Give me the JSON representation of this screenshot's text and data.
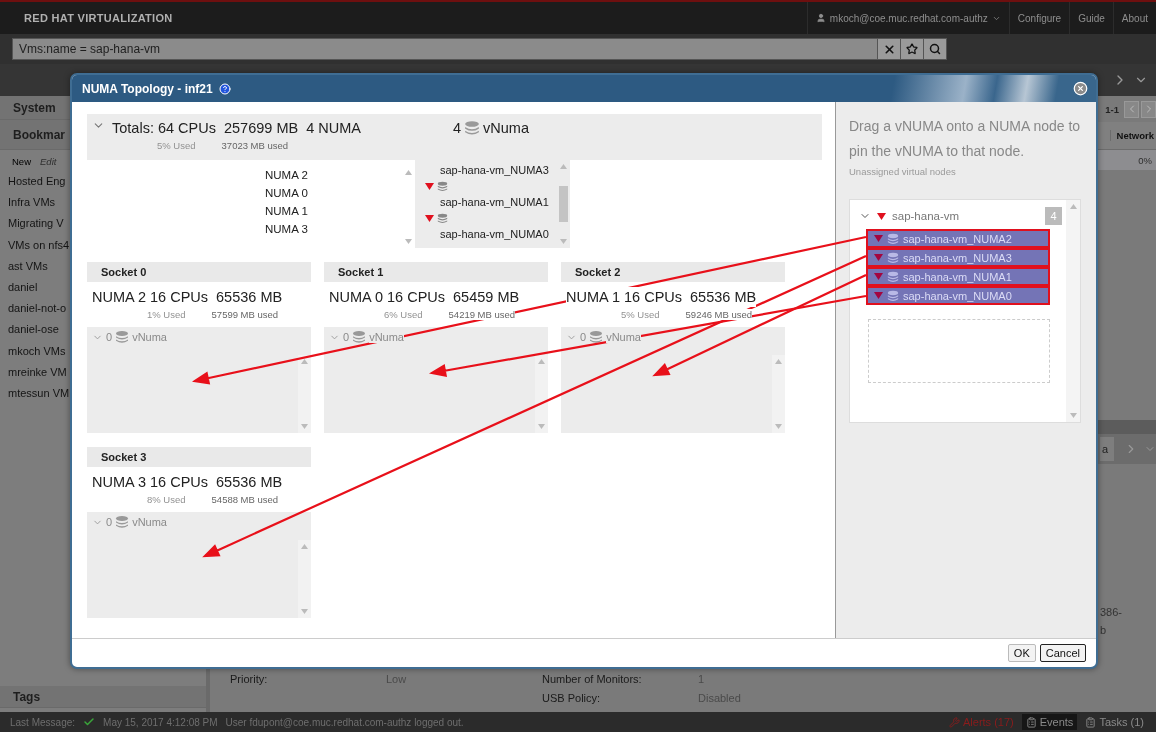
{
  "header": {
    "brand_bold": "RED HAT",
    "brand_rest": "VIRTUALIZATION",
    "user": "mkoch@coe.muc.redhat.com-authz",
    "links": [
      "Configure",
      "Guide",
      "About"
    ]
  },
  "search": {
    "value": "Vms:name = sap-hana-vm"
  },
  "sidebar": {
    "sections": [
      "System",
      "Bookmar"
    ],
    "actions": [
      {
        "label": "New",
        "disabled": false
      },
      {
        "label": "Edit",
        "disabled": true
      }
    ],
    "items": [
      "Hosted Eng",
      "Infra VMs",
      "Migrating V",
      "VMs on nfs4",
      "ast VMs",
      "daniel",
      "daniel-not-o",
      "daniel-ose",
      "mkoch VMs",
      "mreinke VM",
      "mtessun VM"
    ],
    "footer": "Tags"
  },
  "main": {
    "pager": "1-1",
    "column_header": "Network",
    "cell": "0%",
    "subtab": "a",
    "fragments": [
      "386-",
      "b"
    ],
    "details_left": [
      {
        "label": "Priority:",
        "value": "Low"
      }
    ],
    "details_right": [
      {
        "label": "Number of Monitors:",
        "value": "1"
      },
      {
        "label": "USB Policy:",
        "value": "Disabled"
      }
    ]
  },
  "dialog": {
    "title": "NUMA Topology - inf21",
    "totals": {
      "cpus": "Totals: 64 CPUs",
      "memory": "257699 MB",
      "numa": "4 NUMA",
      "cpu_used": "5% Used",
      "mem_used": "37023 MB used",
      "vnuma_count": "4",
      "vnuma_label": "vNuma",
      "numa_nodes": [
        "NUMA 2",
        "NUMA 0",
        "NUMA 1",
        "NUMA 3"
      ],
      "vnuma_nodes": [
        {
          "kind": "cut",
          "name": "sap-hana-vm_NUMA3"
        },
        {
          "kind": "full",
          "name": "sap-hana-vm_NUMA1"
        },
        {
          "kind": "full",
          "name": "sap-hana-vm_NUMA0"
        }
      ]
    },
    "sockets": [
      {
        "title": "Socket 0",
        "numa": "NUMA 2 16 CPUs",
        "memory": "65536 MB",
        "cpu_used": "1% Used",
        "mem_used": "57599 MB used",
        "vnuma_count": "0",
        "vnuma_label": "vNuma"
      },
      {
        "title": "Socket 1",
        "numa": "NUMA 0 16 CPUs",
        "memory": "65459 MB",
        "cpu_used": "6% Used",
        "mem_used": "54219 MB used",
        "vnuma_count": "0",
        "vnuma_label": "vNuma"
      },
      {
        "title": "Socket 2",
        "numa": "NUMA 1 16 CPUs",
        "memory": "65536 MB",
        "cpu_used": "5% Used",
        "mem_used": "59246 MB used",
        "vnuma_count": "0",
        "vnuma_label": "vNuma"
      },
      {
        "title": "Socket 3",
        "numa": "NUMA 3 16 CPUs",
        "memory": "65536 MB",
        "cpu_used": "8% Used",
        "mem_used": "54588 MB used",
        "vnuma_count": "0",
        "vnuma_label": "vNuma"
      }
    ],
    "hint": "Drag a vNUMA onto a NUMA node to pin the vNUMA to that node.",
    "unassigned_label": "Unassigned virtual nodes",
    "vm": {
      "name": "sap-hana-vm",
      "count": "4",
      "nodes": [
        {
          "name": "sap-hana-vm_NUMA2",
          "selected": true
        },
        {
          "name": "sap-hana-vm_NUMA3",
          "selected": true
        },
        {
          "name": "sap-hana-vm_NUMA1",
          "selected": true
        },
        {
          "name": "sap-hana-vm_NUMA0",
          "selected": true
        }
      ]
    },
    "buttons": [
      {
        "label": "OK",
        "focused": false
      },
      {
        "label": "Cancel",
        "focused": true
      }
    ]
  },
  "status_bar": {
    "label": "Last Message:",
    "time": "May 15, 2017 4:12:08 PM",
    "message": "User fdupont@coe.muc.redhat.com-authz logged out.",
    "alerts": "Alerts (17)",
    "events": "Events",
    "tasks": "Tasks (1)"
  }
}
